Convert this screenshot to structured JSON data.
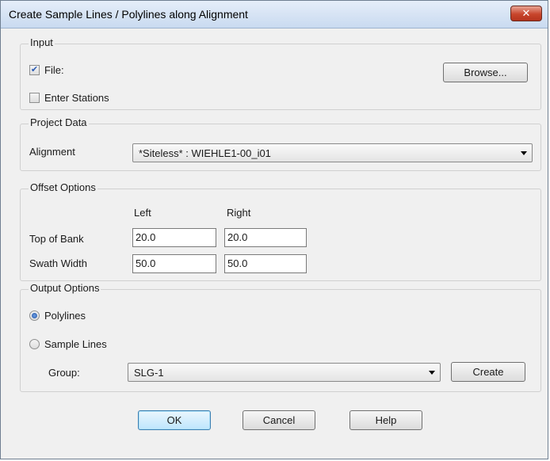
{
  "window": {
    "title": "Create Sample Lines / Polylines along Alignment",
    "close_glyph": "✕"
  },
  "input_group": {
    "legend": "Input",
    "file_label": "File:",
    "file_checked": true,
    "enter_stations_label": "Enter Stations",
    "enter_stations_checked": false,
    "browse_label": "Browse..."
  },
  "project_group": {
    "legend": "Project Data",
    "alignment_label": "Alignment",
    "alignment_value": "*Siteless* : WIEHLE1-00_i01"
  },
  "offset_group": {
    "legend": "Offset Options",
    "col_left": "Left",
    "col_right": "Right",
    "top_of_bank_label": "Top of Bank",
    "top_of_bank_left": "20.0",
    "top_of_bank_right": "20.0",
    "swath_width_label": "Swath Width",
    "swath_width_left": "50.0",
    "swath_width_right": "50.0"
  },
  "output_group": {
    "legend": "Output Options",
    "polylines_label": "Polylines",
    "polylines_selected": true,
    "sample_lines_label": "Sample Lines",
    "sample_lines_selected": false,
    "group_label": "Group:",
    "group_value": "SLG-1",
    "create_label": "Create"
  },
  "footer": {
    "ok_label": "OK",
    "cancel_label": "Cancel",
    "help_label": "Help"
  }
}
